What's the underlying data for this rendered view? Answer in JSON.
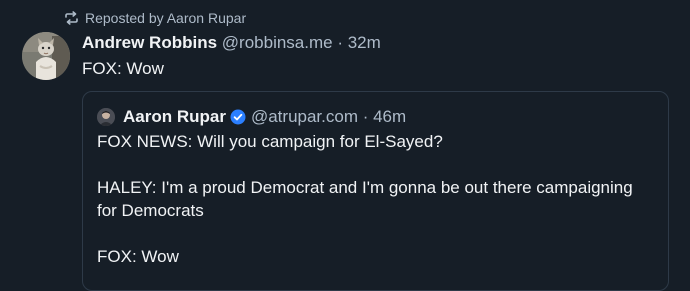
{
  "repost": {
    "label": "Reposted by Aaron Rupar",
    "icon": "repost-icon"
  },
  "post": {
    "display_name": "Andrew Robbins",
    "meta": "@robbinsa.me · 32m",
    "text": "FOX: Wow",
    "avatar_icon": "cat-avatar"
  },
  "quote": {
    "display_name": "Aaron Rupar",
    "meta": "@atrupar.com · 46m",
    "verified_icon": "verified-check-icon",
    "paragraphs": [
      "FOX NEWS: Will you campaign for El-Sayed?",
      "HALEY: I'm a proud Democrat and I'm gonna be out there campaigning for Democrats",
      "FOX: Wow"
    ]
  },
  "colors": {
    "background": "#161e27",
    "text": "#f1f3f5",
    "muted": "#aebbc9",
    "border": "#2e3a48",
    "verified": "#2b7fff"
  }
}
